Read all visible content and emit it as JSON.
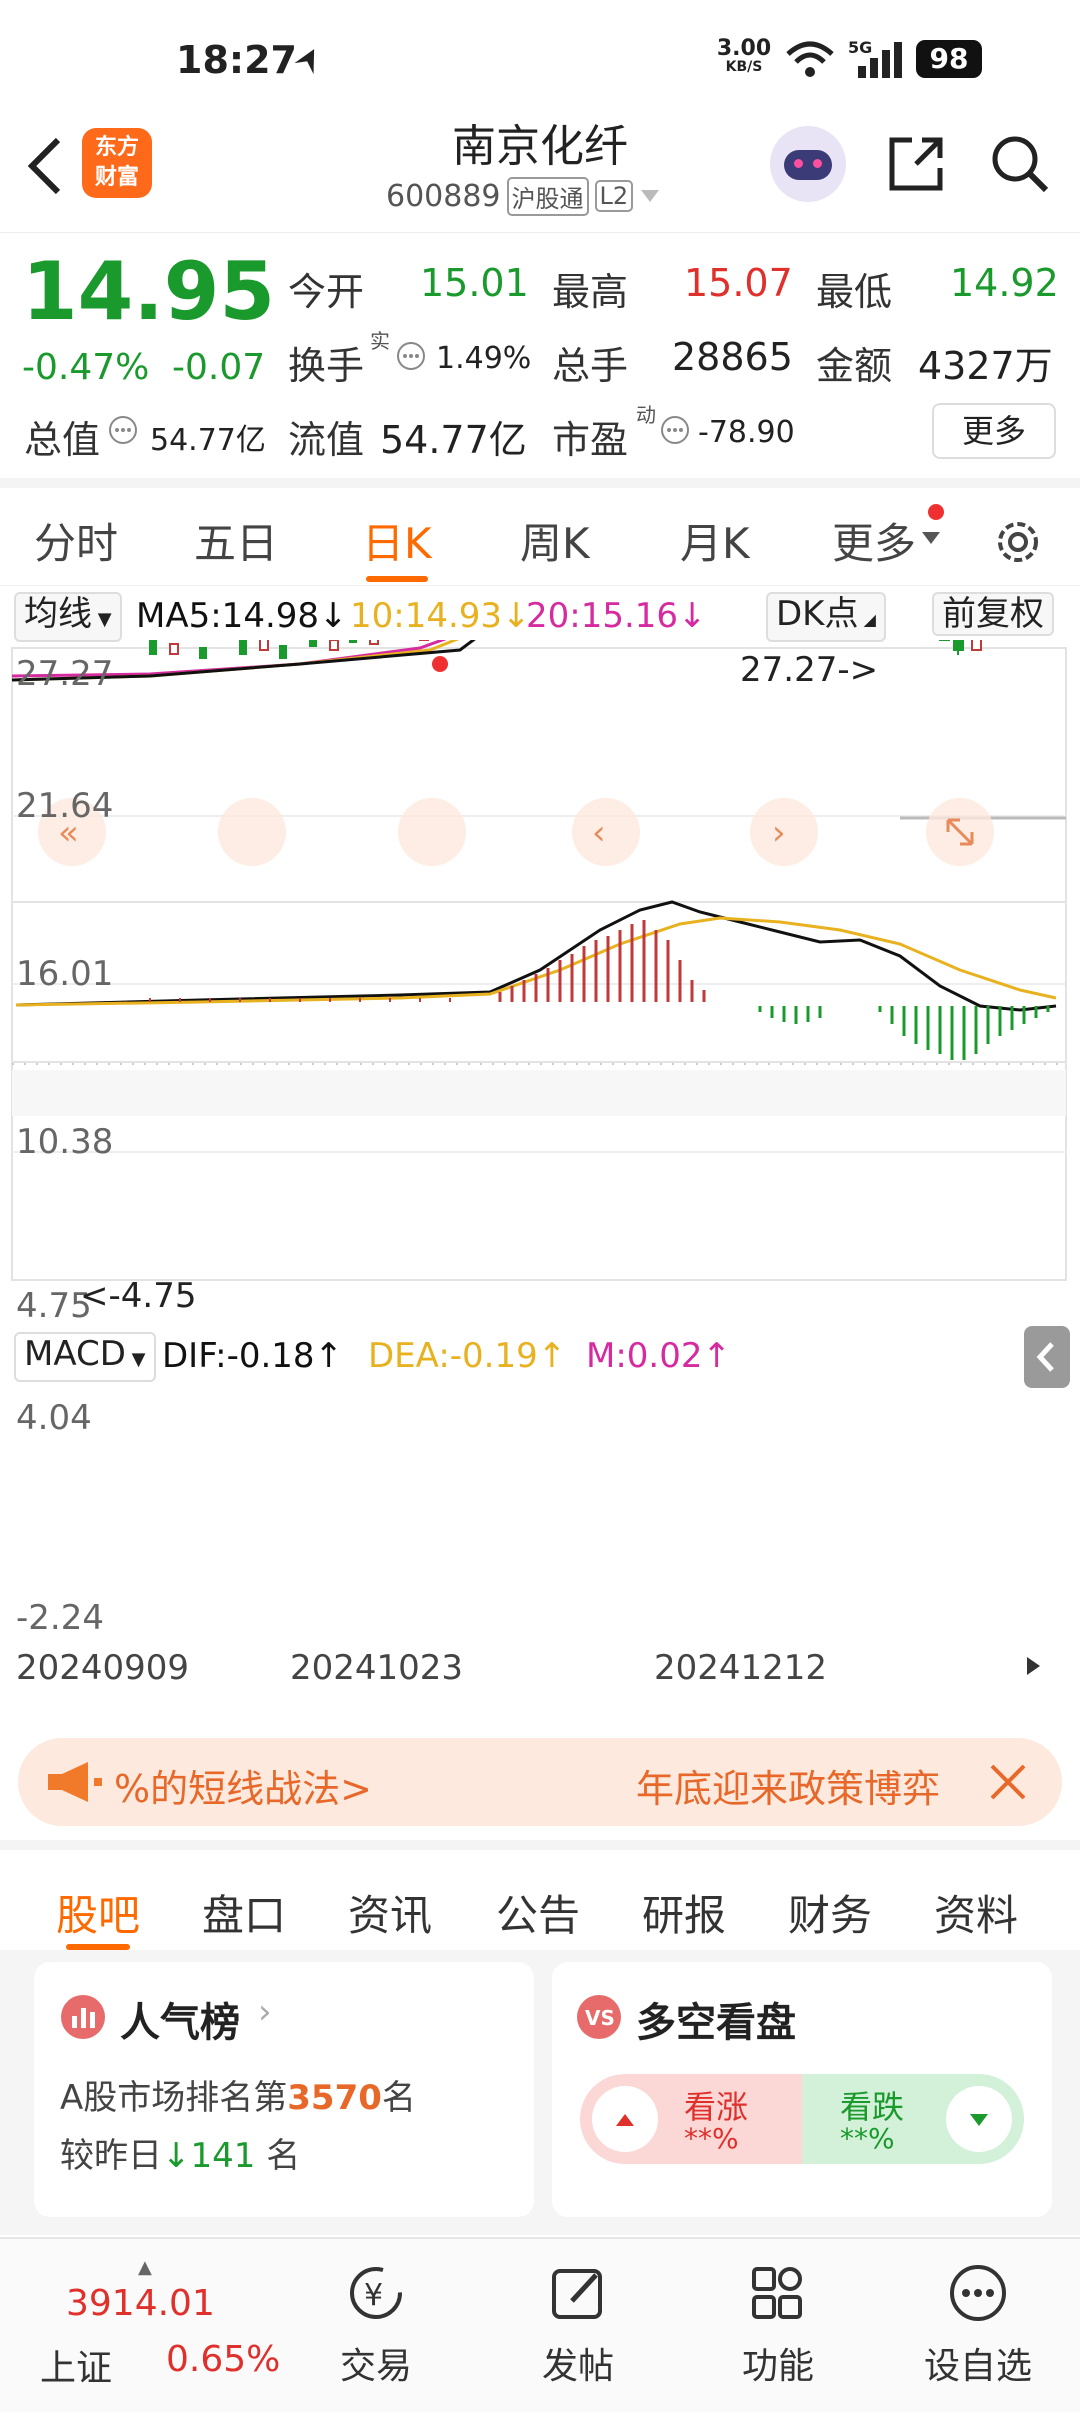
{
  "status": {
    "time": "18:27",
    "net_speed": "3.00",
    "net_unit": "KB/S",
    "signal_type": "5G",
    "battery": "98"
  },
  "header": {
    "logo_line1": "东方",
    "logo_line2": "财富",
    "title": "南京化纤",
    "code": "600889",
    "tag_hgt": "沪股通",
    "tag_l2": "L2"
  },
  "quote": {
    "price": "14.95",
    "change_pct": "-0.47%",
    "change": "-0.07",
    "open_label": "今开",
    "open": "15.01",
    "high_label": "最高",
    "high": "15.07",
    "low_label": "最低",
    "low": "14.92",
    "turnover_label": "换手",
    "turnover_sup": "实",
    "turnover": "1.49%",
    "volume_label": "总手",
    "volume": "28865",
    "amount_label": "金额",
    "amount": "4327万",
    "mktcap_label": "总值",
    "mktcap": "54.77亿",
    "float_label": "流值",
    "float": "54.77亿",
    "pe_label": "市盈",
    "pe_sup": "动",
    "pe": "-78.90",
    "more": "更多"
  },
  "tabs": [
    "分时",
    "五日",
    "日K",
    "周K",
    "月K",
    "更多"
  ],
  "indicators": {
    "ma_select": "均线",
    "ma5": "MA5:14.98↓",
    "ma10": "10:14.93↓",
    "ma20": "20:15.16↓",
    "dk": "DK点",
    "adj": "前复权"
  },
  "chart_labels": {
    "price_ticks": [
      "27.27",
      "21.64",
      "16.01",
      "10.38",
      "4.75"
    ],
    "max_mark": "27.27->",
    "min_mark": "<-4.75",
    "macd_select": "MACD",
    "dif": "DIF:-0.18↑",
    "dea": "DEA:-0.19↑",
    "m": "M:0.02↑",
    "macd_ticks": [
      "4.04",
      "-2.24"
    ],
    "dates": [
      "20240909",
      "20241023",
      "20241212"
    ]
  },
  "colors": {
    "up": "#e0302c",
    "down": "#1a9a2c",
    "ma5": "#111111",
    "ma10": "#e8b11f",
    "ma20": "#d62aa0",
    "accent": "#ff6a00"
  },
  "chart_data": {
    "type": "line",
    "x": [
      "20240909",
      "20241023",
      "20241212"
    ],
    "ylim": [
      4.75,
      27.27
    ],
    "series": [
      {
        "name": "MA5",
        "values": [
          14.98
        ]
      },
      {
        "name": "10",
        "values": [
          14.93
        ]
      },
      {
        "name": "20",
        "values": [
          15.16
        ]
      }
    ],
    "macd": {
      "ylim": [
        -2.24,
        4.04
      ],
      "DIF": -0.18,
      "DEA": -0.19,
      "M": 0.02
    }
  },
  "banner": {
    "left": "%的短线战法>",
    "right": "年底迎来政策博弈"
  },
  "bottom_tabs": [
    "股吧",
    "盘口",
    "资讯",
    "公告",
    "研报",
    "财务",
    "资料"
  ],
  "cards": {
    "popularity_title": "人气榜",
    "rank_prefix": "A股市场排名第",
    "rank": "3570",
    "rank_suffix": "名",
    "compare_prefix": "较昨日",
    "compare_value": "141",
    "compare_suffix": "名",
    "bullbear_title": "多空看盘",
    "bull_label": "看涨",
    "bull_value": "**%",
    "bear_label": "看跌",
    "bear_value": "**%"
  },
  "tabbar": {
    "index_value": "3914.01",
    "index_name": "上证",
    "index_change": "0.65%",
    "trade": "交易",
    "post": "发帖",
    "func": "功能",
    "watchlist": "设自选"
  }
}
